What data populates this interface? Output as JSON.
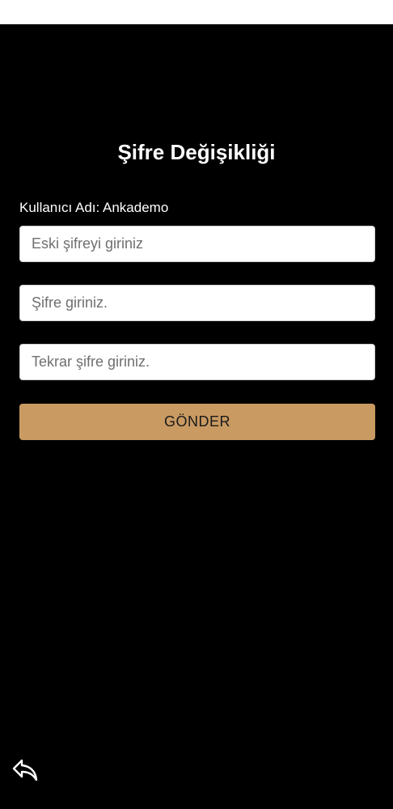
{
  "header": {
    "title": "Şifre Değişikliği"
  },
  "user": {
    "label": "Kullanıcı Adı: Ankademo"
  },
  "form": {
    "old_password_placeholder": "Eski şifreyi giriniz",
    "new_password_placeholder": "Şifre giriniz.",
    "repeat_password_placeholder": "Tekrar şifre giriniz.",
    "submit_label": "GÖNDER"
  },
  "navigation": {
    "back_icon": "reply-arrow-icon"
  },
  "colors": {
    "background": "#000000",
    "accent": "#c99a62",
    "input_background": "#ffffff",
    "text": "#ffffff"
  }
}
